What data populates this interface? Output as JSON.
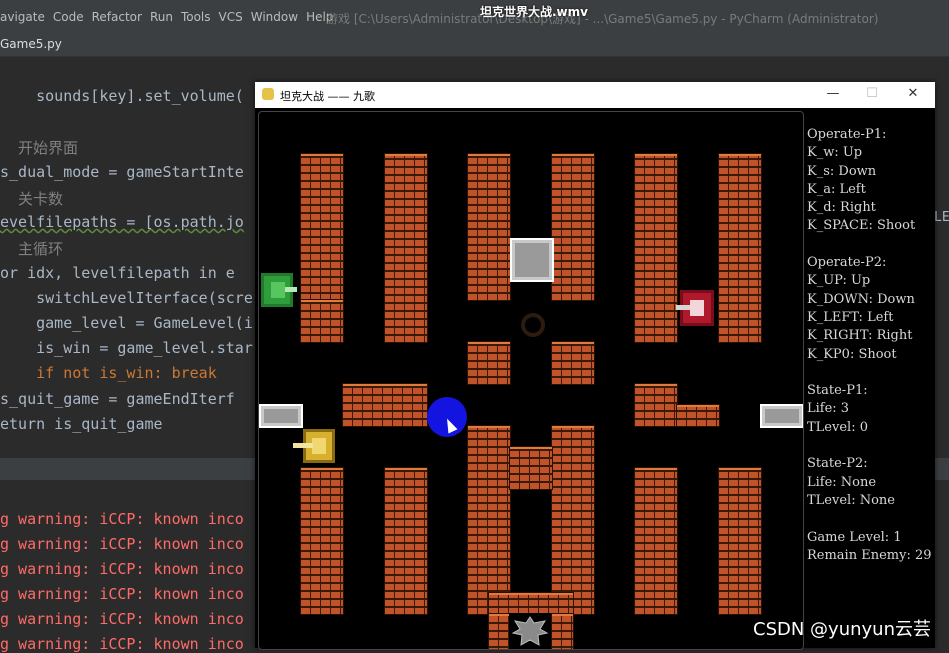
{
  "video_title": "坦克世界大战.wmv",
  "ide": {
    "menu": [
      "avigate",
      "Code",
      "Refactor",
      "Run",
      "Tools",
      "VCS",
      "Window",
      "Help"
    ],
    "path": "游戏 [C:\\Users\\Administrator\\Desktop\\游戏] - ...\\Game5\\Game5.py - PyCharm (Administrator)",
    "tab": "Game5.py",
    "code": [
      "    sounds[key].set_volume(",
      "  开始界面",
      "s_dual_mode = gameStartInte",
      "  关卡数",
      "evelfilepaths = [os.path.jo",
      "  主循环",
      "or idx, levelfilepath in e",
      "    switchLevelIterface(scre",
      "    game_level = GameLevel(i",
      "    is_win = game_level.star",
      "    if not is_win: break",
      "s_quit_game = gameEndIterf",
      "eturn is_quit_game"
    ],
    "right_edge_text": "LE",
    "console_lines": [
      "g warning: iCCP: known inco",
      "g warning: iCCP: known inco",
      "g warning: iCCP: known inco",
      "g warning: iCCP: known inco",
      "g warning: iCCP: known inco",
      "g warning: iCCP: known inco"
    ]
  },
  "game_window": {
    "title": "坦克大战 —— 九歌",
    "buttons": {
      "minimize": "—",
      "maximize": "☐",
      "close": "✕"
    },
    "info": [
      "Operate-P1:",
      "K_w: Up",
      "K_s: Down",
      "K_a: Left",
      "K_d: Right",
      "K_SPACE: Shoot",
      "",
      "Operate-P2:",
      "K_UP: Up",
      "K_DOWN: Down",
      "K_LEFT: Left",
      "K_RIGHT: Right",
      "K_KP0: Shoot",
      "",
      "State-P1:",
      "Life: 3",
      "TLevel: 0",
      "",
      "State-P2:",
      "Life: None",
      "TLevel: None",
      "",
      "Game Level: 1",
      "Remain Enemy: 29"
    ]
  },
  "watermark": "CSDN @yunyun云芸",
  "colors": {
    "brick": "#c0532a",
    "player_tank": "#d8b030",
    "enemy_green": "#2f9e3a",
    "enemy_red": "#b0182c",
    "blue_dot": "#1414e0"
  }
}
